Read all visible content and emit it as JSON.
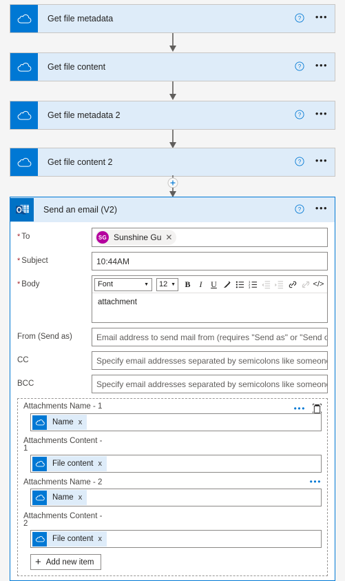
{
  "flow": {
    "steps": [
      {
        "title": "Get file metadata",
        "icon": "onedrive-cloud-icon",
        "help": "?",
        "more": "•••"
      },
      {
        "title": "Get file content",
        "icon": "onedrive-cloud-icon",
        "help": "?",
        "more": "•••"
      },
      {
        "title": "Get file metadata 2",
        "icon": "onedrive-cloud-icon",
        "help": "?",
        "more": "•••"
      },
      {
        "title": "Get file content 2",
        "icon": "onedrive-cloud-icon",
        "help": "?",
        "more": "•••"
      }
    ],
    "insert_step_label": "+"
  },
  "email_card": {
    "title": "Send an email (V2)",
    "icon": "outlook-icon",
    "help": "?",
    "more": "•••",
    "accent_color": "#0078d4",
    "header_bg": "#deecf9",
    "fields": {
      "to": {
        "label": "To",
        "required": true,
        "recipient": {
          "name": "Sunshine Gu",
          "initials": "SG",
          "avatar_color": "#b4009e",
          "remove": "✕"
        }
      },
      "subject": {
        "label": "Subject",
        "required": true,
        "value": "10:44AM"
      },
      "body": {
        "label": "Body",
        "required": true,
        "value": "attachment",
        "toolbar": {
          "font_name": "Font",
          "font_size": "12",
          "bold": "B",
          "italic": "I",
          "underline": "U",
          "text_color": "✎",
          "bullet_list": "≣",
          "number_list": "≣",
          "indent": "≣",
          "outdent": "≣",
          "link": "⚭",
          "unlink": "⚭",
          "code_view": "</>"
        }
      },
      "from": {
        "label": "From (Send as)",
        "required": false,
        "value": "",
        "placeholder": "Email address to send mail from (requires \"Send as\" or \"Send on b..."
      },
      "cc": {
        "label": "CC",
        "required": false,
        "value": "",
        "placeholder": "Specify email addresses separated by semicolons like someone@c..."
      },
      "bcc": {
        "label": "BCC",
        "required": false,
        "value": "",
        "placeholder": "Specify email addresses separated by semicolons like someone@c..."
      }
    },
    "attachments": {
      "delete_icon": "trash-icon",
      "more": "•••",
      "items": [
        {
          "label": "Attachments Name - 1",
          "token_text": "Name",
          "token_icon": "onedrive-cloud-icon",
          "token_remove": "x",
          "has_more": true,
          "has_delete": true
        },
        {
          "label": "Attachments Content - 1",
          "token_text": "File content",
          "token_icon": "onedrive-cloud-icon",
          "token_remove": "x",
          "has_more": false,
          "has_delete": false
        },
        {
          "label": "Attachments Name - 2",
          "token_text": "Name",
          "token_icon": "onedrive-cloud-icon",
          "token_remove": "x",
          "has_more": true,
          "has_delete": false
        },
        {
          "label": "Attachments Content - 2",
          "token_text": "File content",
          "token_icon": "onedrive-cloud-icon",
          "token_remove": "x",
          "has_more": false,
          "has_delete": false
        }
      ],
      "add_new_item": "Add new item",
      "add_plus": "+"
    }
  }
}
